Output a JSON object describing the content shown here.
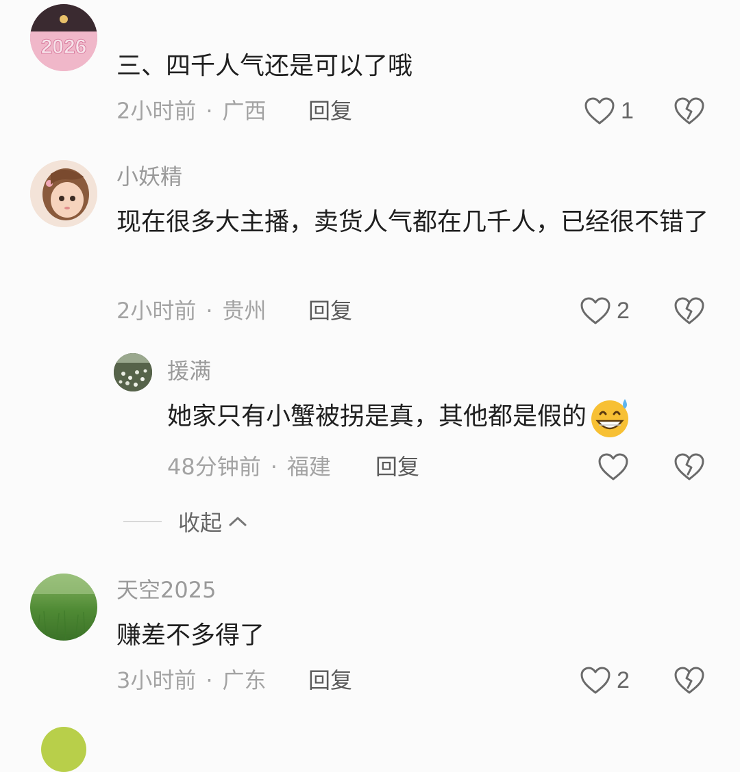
{
  "comments": [
    {
      "username": "",
      "content": "三、四千人气还是可以了哦",
      "time": "2小时前",
      "location": "广西",
      "reply_label": "回复",
      "likes": "1",
      "avatar_text": "2026"
    },
    {
      "username": "小妖精",
      "content": "现在很多大主播，卖货人气都在几千人，已经很不错了",
      "time": "2小时前",
      "location": "贵州",
      "reply_label": "回复",
      "likes": "2"
    },
    {
      "username": "天空2025",
      "content": "赚差不多得了",
      "time": "3小时前",
      "location": "广东",
      "reply_label": "回复",
      "likes": "2"
    }
  ],
  "sub_reply": {
    "username": "援满",
    "content": "她家只有小蟹被拐是真，其他都是假的",
    "time": "48分钟前",
    "location": "福建",
    "reply_label": "回复",
    "likes": ""
  },
  "collapse_label": "收起",
  "icons": {
    "like": "heart-outline-icon",
    "dislike": "broken-heart-icon",
    "collapse": "chevron-up-icon",
    "emoji": "grinning-sweat-emoji"
  }
}
